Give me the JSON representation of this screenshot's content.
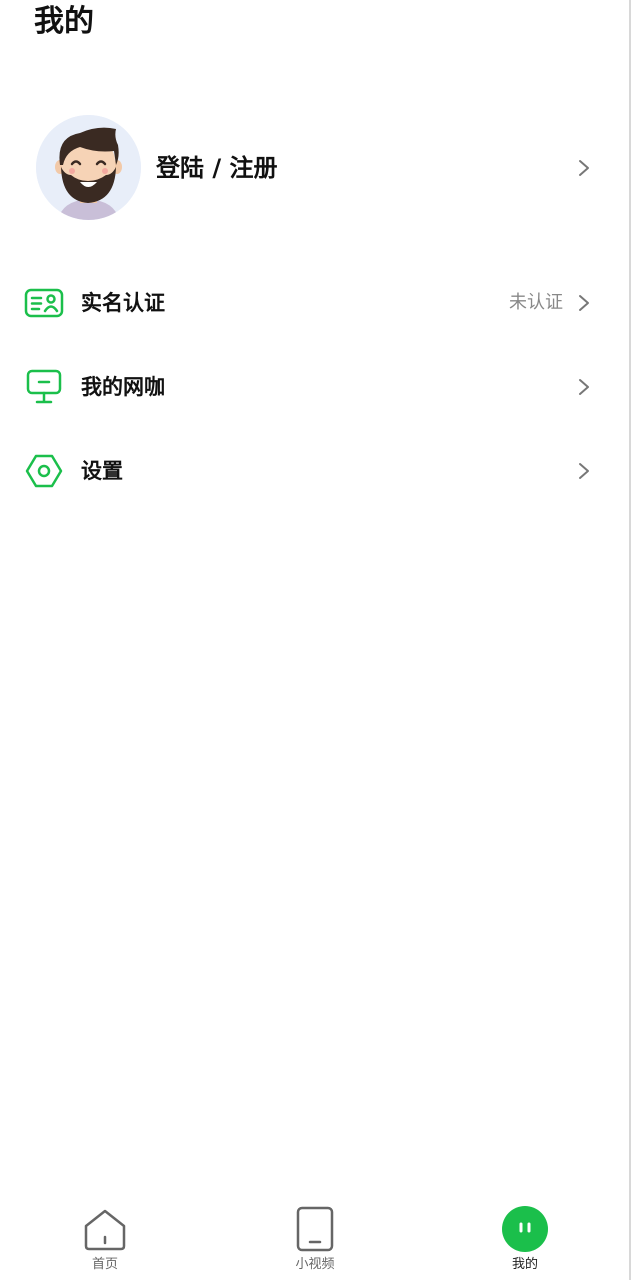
{
  "page": {
    "title": "我的"
  },
  "profile": {
    "login_label": "登陆 / 注册"
  },
  "menu": [
    {
      "label": "实名认证",
      "value": "未认证",
      "icon": "id-card-icon"
    },
    {
      "label": "我的网咖",
      "value": "",
      "icon": "monitor-icon"
    },
    {
      "label": "设置",
      "value": "",
      "icon": "settings-hexagon-icon"
    }
  ],
  "tabbar": {
    "tabs": [
      {
        "label": "首页",
        "icon": "home-icon",
        "active": false
      },
      {
        "label": "小视频",
        "icon": "tablet-icon",
        "active": false
      },
      {
        "label": "我的",
        "icon": "face-icon",
        "active": true
      }
    ]
  },
  "colors": {
    "accent": "#1bbf4b",
    "text_primary": "#111111",
    "text_secondary": "#888888",
    "avatar_bg": "#e8eef9"
  }
}
